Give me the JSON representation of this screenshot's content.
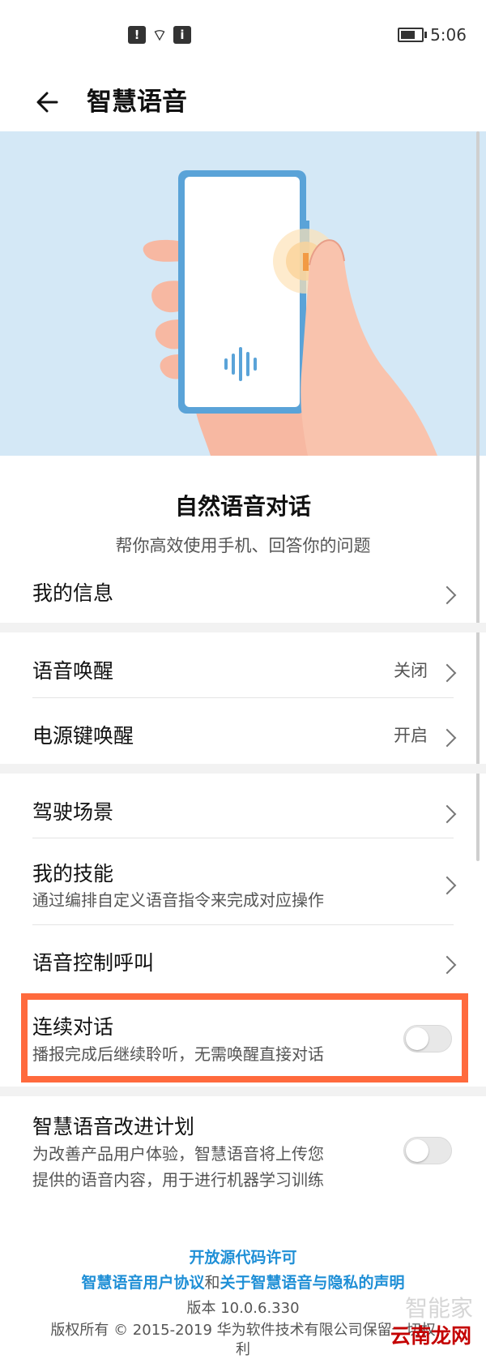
{
  "status": {
    "time": "5:06",
    "battery_level": 0.7
  },
  "header": {
    "title": "智慧语音"
  },
  "intro": {
    "title": "自然语音对话",
    "subtitle": "帮你高效使用手机、回答你的问题"
  },
  "items": {
    "my_info": {
      "label": "我的信息"
    },
    "voice_wakeup": {
      "label": "语音唤醒",
      "value": "关闭"
    },
    "power_wakeup": {
      "label": "电源键唤醒",
      "value": "开启"
    },
    "driving": {
      "label": "驾驶场景"
    },
    "skills": {
      "label": "我的技能",
      "desc": "通过编排自定义语音指令来完成对应操作"
    },
    "call": {
      "label": "语音控制呼叫"
    },
    "continuous": {
      "label": "连续对话",
      "desc": "播报完成后继续聆听，无需唤醒直接对话",
      "enabled": false
    },
    "improve": {
      "label": "智慧语音改进计划",
      "desc_line1": "为改善产品用户体验，智慧语音将上传您",
      "desc_line2": "提供的语音内容，用于进行机器学习训练",
      "enabled": false
    }
  },
  "footer": {
    "open_source": "开放源代码许可",
    "agreement": "智慧语音用户协议",
    "and": "和",
    "privacy": "关于智慧语音与隐私的声明",
    "version": "版本  10.0.6.330",
    "copyright_line1": "版权所有 © 2015-2019 华为软件技术有限公司保留一切权",
    "copyright_line2": "利"
  },
  "watermark": {
    "main": "云南龙网",
    "faded": "智能家"
  },
  "colors": {
    "accent": "#1f8fd6",
    "highlight": "#ff6a3d",
    "hero_bg": "#d4e8f6"
  }
}
